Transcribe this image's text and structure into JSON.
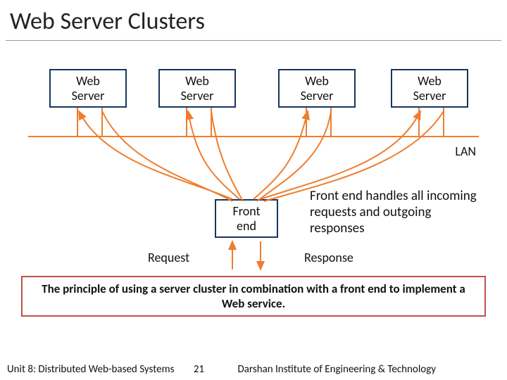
{
  "title": "Web Server Clusters",
  "boxes": {
    "ws1": "Web\nServer",
    "ws2": "Web\nServer",
    "ws3": "Web\nServer",
    "ws4": "Web\nServer",
    "frontend": "Front\nend"
  },
  "lan_label": "LAN",
  "annotation": "Front end handles all incoming requests and outgoing responses",
  "req_label": "Request",
  "resp_label": "Response",
  "caption": "The principle of using a server cluster in combination with a front end to implement a Web service.",
  "footer": {
    "unit": "Unit 8: Distributed Web-based Systems",
    "page": "21",
    "institute": "Darshan Institute of Engineering & Technology"
  },
  "colors": {
    "box_border": "#16365d",
    "lan": "#ef7d2e",
    "caption_border": "#c0504d"
  }
}
